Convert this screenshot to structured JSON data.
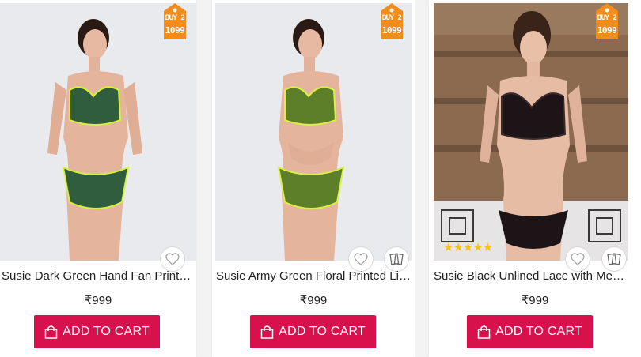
{
  "offer": {
    "line1": "BUY 2",
    "line2": "1099"
  },
  "products": [
    {
      "name": "Susie Dark Green Hand Fan Print Lined Non-Wired Bra and Panty Set",
      "price": "₹999",
      "cart_label": "ADD TO CART",
      "rating": "",
      "colors": {
        "bg": "#e9eaee",
        "set": "#2f5d3d",
        "trim": "#d6f23b"
      }
    },
    {
      "name": "Susie Army Green Floral Printed Lined Bra and Panty Set",
      "price": "₹999",
      "cart_label": "ADD TO CART",
      "rating": "",
      "colors": {
        "bg": "#e9eaee",
        "set": "#5e7f2a",
        "trim": "#d9f045"
      }
    },
    {
      "name": "Susie Black Unlined Lace with Mesh Bra and Panty Set",
      "price": "₹999",
      "cart_label": "ADD TO CART",
      "rating": "★★★★★",
      "colors": {
        "bg": "#8b6a4f",
        "set": "#1c1416",
        "trim": "#3a2a2c"
      }
    }
  ],
  "colors": {
    "accent": "#d6114c",
    "tag": "#f28c1b",
    "star": "#f3c21b"
  }
}
